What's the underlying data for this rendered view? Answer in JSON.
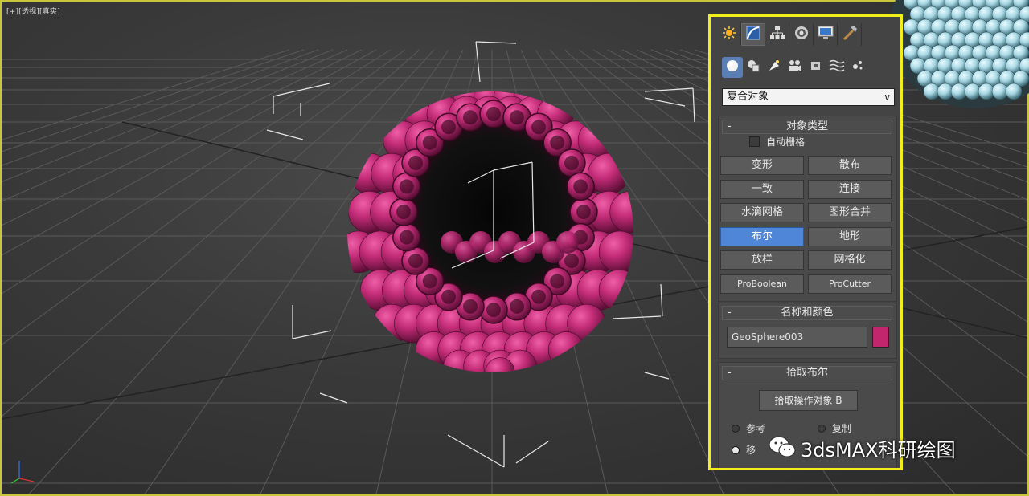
{
  "viewport": {
    "label": "[+][透视][真实]"
  },
  "panel": {
    "tabs": [
      {
        "icon": "create-icon"
      },
      {
        "icon": "modify-icon"
      },
      {
        "icon": "hierarchy-icon"
      },
      {
        "icon": "motion-icon"
      },
      {
        "icon": "display-icon"
      },
      {
        "icon": "utilities-icon"
      }
    ],
    "subcategories": [
      {
        "icon": "geometry-icon"
      },
      {
        "icon": "shapes-icon"
      },
      {
        "icon": "lights-icon"
      },
      {
        "icon": "cameras-icon"
      },
      {
        "icon": "helpers-icon"
      },
      {
        "icon": "space-warps-icon"
      },
      {
        "icon": "systems-icon"
      }
    ],
    "category_select": "复合对象",
    "object_type": {
      "title": "对象类型",
      "collapse": "-",
      "autogrid_label": "自动栅格",
      "buttons": [
        "变形",
        "散布",
        "一致",
        "连接",
        "水滴网格",
        "图形合并",
        "布尔",
        "地形",
        "放样",
        "网格化",
        "ProBoolean",
        "ProCutter"
      ],
      "selected": "布尔"
    },
    "name_color": {
      "title": "名称和颜色",
      "collapse": "-",
      "name_value": "GeoSphere003",
      "swatch_color": "#c2276e"
    },
    "pick_boolean": {
      "title": "拾取布尔",
      "collapse": "-",
      "pick_button": "拾取操作对象 B",
      "options": [
        "参考",
        "复制",
        "移"
      ]
    }
  },
  "colors": {
    "object_magenta": "#b8236b",
    "panel_highlight": "#f2ee1c",
    "viewport_border": "#c9c63c",
    "selected_button": "#4f86d8"
  },
  "watermark": {
    "icon": "wechat-icon",
    "text": "3dsMAX科研绘图"
  }
}
